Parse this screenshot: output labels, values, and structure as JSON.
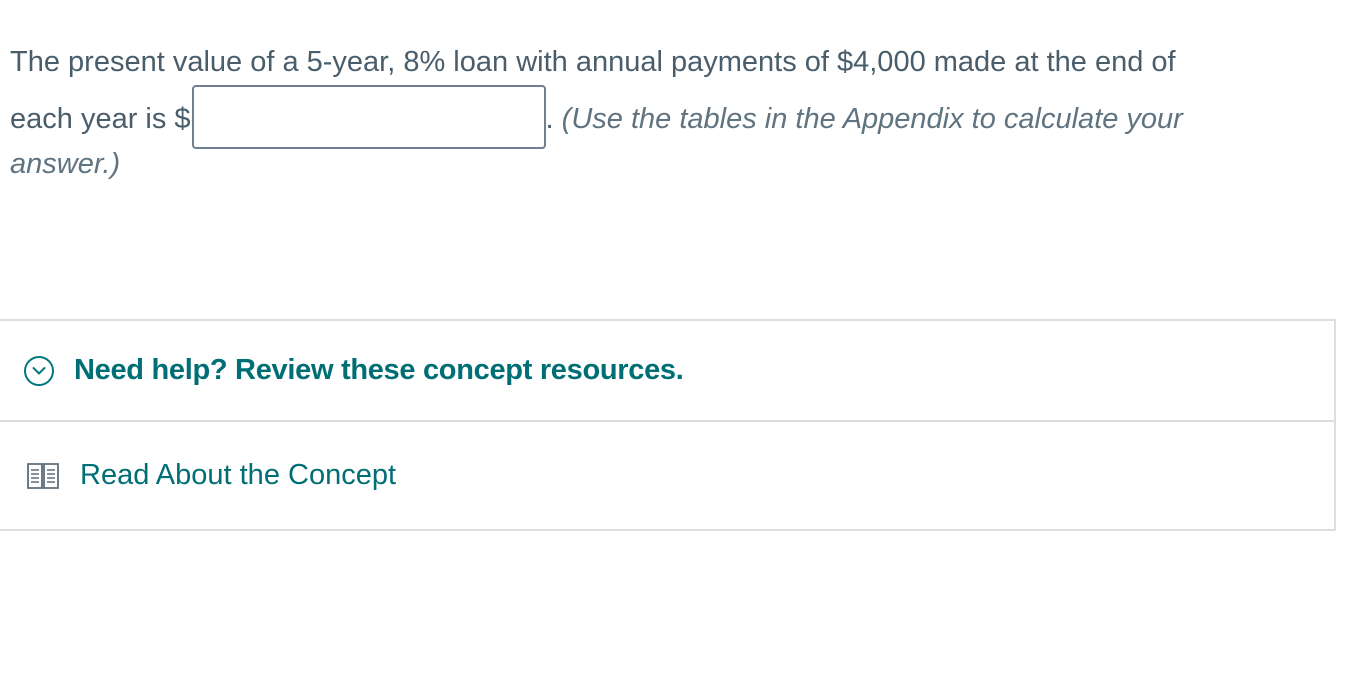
{
  "question": {
    "text_before": "The present value of a 5-year, 8% loan with annual payments of $4,000 made at the end of",
    "text_line2_before_input": "each year is $",
    "answer_value": "",
    "answer_placeholder": "",
    "period": ".",
    "hint_line2": " (Use the tables in the Appendix to calculate your",
    "hint_line3": "answer.)"
  },
  "resources": {
    "help_title": "Need help? Review these concept resources.",
    "help_icon": "chevron-down-circle-icon",
    "concept_link": "Read About the Concept",
    "concept_icon": "book-icon"
  },
  "colors": {
    "accent": "#006f75",
    "body_text": "#4a5d6b",
    "border": "#dcdfe2"
  }
}
